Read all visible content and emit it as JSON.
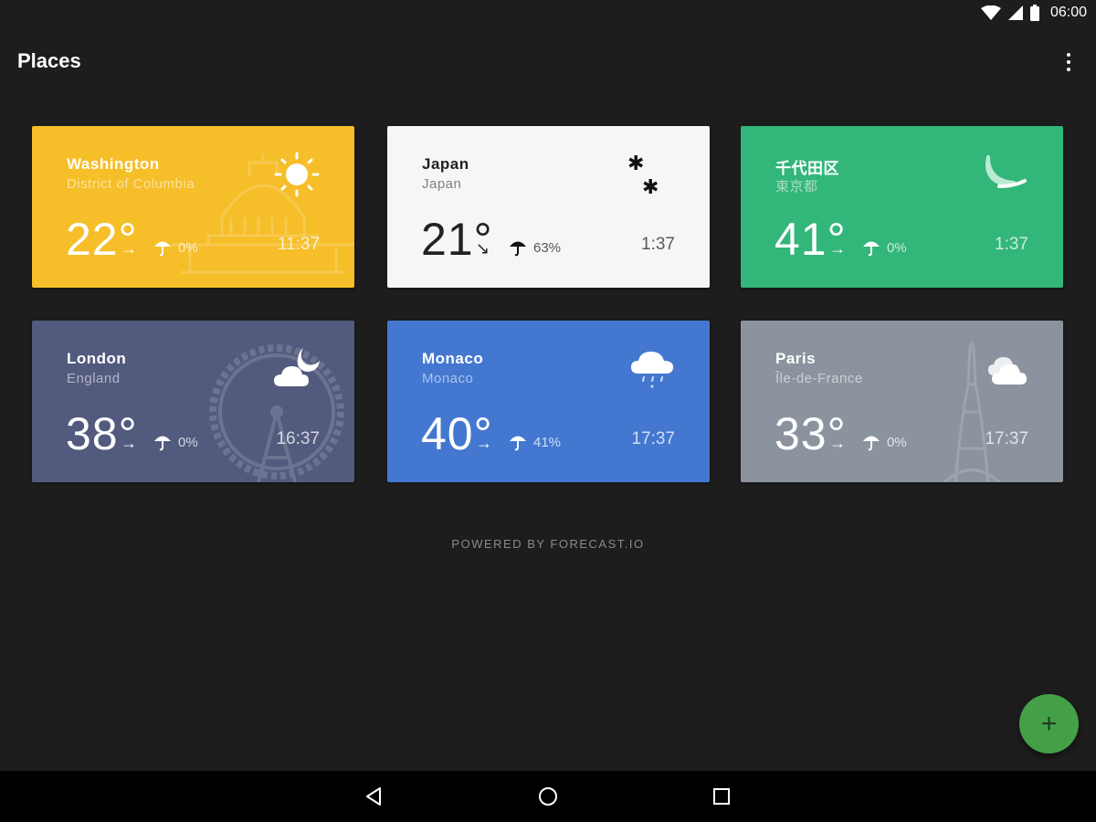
{
  "status_bar": {
    "time": "06:00",
    "icons": [
      "wifi-icon",
      "cell-signal-icon",
      "battery-icon"
    ]
  },
  "app_bar": {
    "title": "Places",
    "menu_icon": "more-vert-icon"
  },
  "cards": [
    {
      "city": "Washington",
      "region": "District of Columbia",
      "temp": "22°",
      "wind": "→",
      "precip": "0%",
      "time": "11:37",
      "weather_icon": "sun-icon",
      "background": "#f6be28",
      "text_color": "#ffffff"
    },
    {
      "city": "Japan",
      "region": "Japan",
      "temp": "21°",
      "wind": "↘",
      "precip": "63%",
      "time": "1:37",
      "weather_icon": "snow-icon",
      "background": "#f6f6f6",
      "text_color": "#222222"
    },
    {
      "city": "千代田区",
      "region": "東京都",
      "temp": "41°",
      "wind": "→",
      "precip": "0%",
      "time": "1:37",
      "weather_icon": "moon-icon",
      "background": "#33b679",
      "text_color": "#ffffff"
    },
    {
      "city": "London",
      "region": "England",
      "temp": "38°",
      "wind": "→",
      "precip": "0%",
      "time": "16:37",
      "weather_icon": "partly-cloudy-night-icon",
      "background": "#525a7e",
      "text_color": "#ffffff"
    },
    {
      "city": "Monaco",
      "region": "Monaco",
      "temp": "40°",
      "wind": "→",
      "precip": "41%",
      "time": "17:37",
      "weather_icon": "rain-cloud-icon",
      "background": "#4478d0",
      "text_color": "#ffffff"
    },
    {
      "city": "Paris",
      "region": "Île-de-France",
      "temp": "33°",
      "wind": "→",
      "precip": "0%",
      "time": "17:37",
      "weather_icon": "cloudy-icon",
      "background": "#8b949e",
      "text_color": "#ffffff"
    }
  ],
  "footer": "POWERED BY FORECAST.IO",
  "fab": {
    "label": "+",
    "icon": "add-icon",
    "color": "#43a047"
  },
  "nav_bar": {
    "icons": [
      "back-icon",
      "home-icon",
      "recents-icon"
    ]
  }
}
